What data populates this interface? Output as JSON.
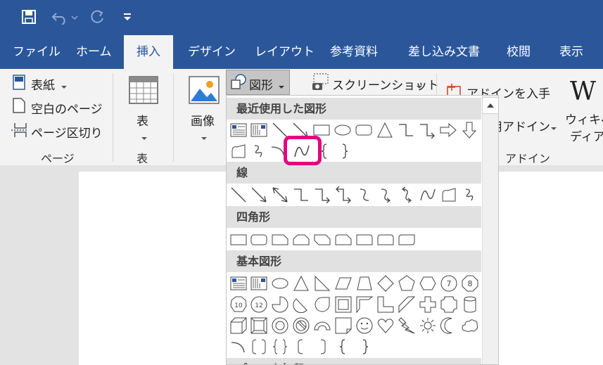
{
  "tabs": [
    "ファイル",
    "ホーム",
    "挿入",
    "デザイン",
    "レイアウト",
    "参考資料",
    "差し込み文書",
    "校閲",
    "表示"
  ],
  "active_tab": "挿入",
  "ribbon": {
    "cover_page": "表紙",
    "blank_page": "空白のページ",
    "page_break": "ページ区切り",
    "pages_group": "ページ",
    "table_button": "表",
    "table_group": "表",
    "pictures_button": "画像",
    "shapes_button": "図形",
    "screenshot_button": "スクリーンショット",
    "get_addins": "アドインを入手",
    "my_addins": "個人用アドイン",
    "addins_group": "アドイン",
    "wikipedia_line1": "ウィキペ",
    "wikipedia_line2": "ディア"
  },
  "shapes_menu": {
    "sections": [
      "最近使用した図形",
      "線",
      "四角形",
      "基本図形",
      "ブロック矢印"
    ]
  },
  "colors": {
    "ribbon_blue": "#2b579a",
    "highlight": "#e4007f"
  }
}
